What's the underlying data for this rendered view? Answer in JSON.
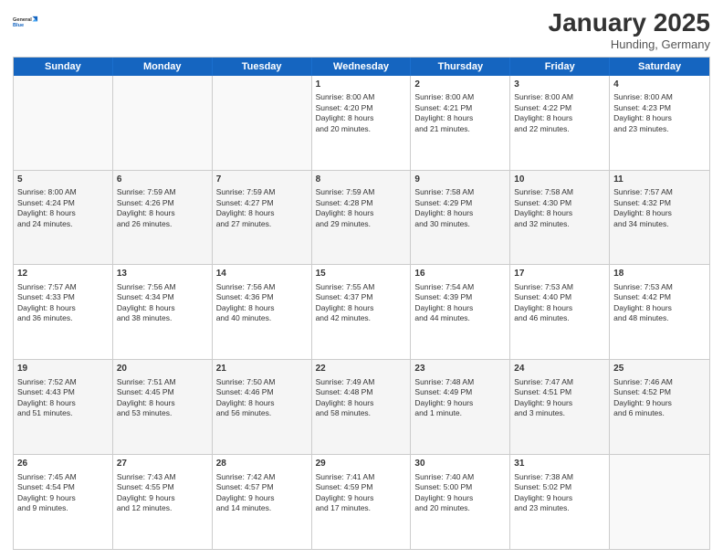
{
  "header": {
    "logo_line1": "General",
    "logo_line2": "Blue",
    "month": "January 2025",
    "location": "Hunding, Germany"
  },
  "days_of_week": [
    "Sunday",
    "Monday",
    "Tuesday",
    "Wednesday",
    "Thursday",
    "Friday",
    "Saturday"
  ],
  "weeks": [
    [
      {
        "num": "",
        "content": ""
      },
      {
        "num": "",
        "content": ""
      },
      {
        "num": "",
        "content": ""
      },
      {
        "num": "1",
        "content": "Sunrise: 8:00 AM\nSunset: 4:20 PM\nDaylight: 8 hours\nand 20 minutes."
      },
      {
        "num": "2",
        "content": "Sunrise: 8:00 AM\nSunset: 4:21 PM\nDaylight: 8 hours\nand 21 minutes."
      },
      {
        "num": "3",
        "content": "Sunrise: 8:00 AM\nSunset: 4:22 PM\nDaylight: 8 hours\nand 22 minutes."
      },
      {
        "num": "4",
        "content": "Sunrise: 8:00 AM\nSunset: 4:23 PM\nDaylight: 8 hours\nand 23 minutes."
      }
    ],
    [
      {
        "num": "5",
        "content": "Sunrise: 8:00 AM\nSunset: 4:24 PM\nDaylight: 8 hours\nand 24 minutes."
      },
      {
        "num": "6",
        "content": "Sunrise: 7:59 AM\nSunset: 4:26 PM\nDaylight: 8 hours\nand 26 minutes."
      },
      {
        "num": "7",
        "content": "Sunrise: 7:59 AM\nSunset: 4:27 PM\nDaylight: 8 hours\nand 27 minutes."
      },
      {
        "num": "8",
        "content": "Sunrise: 7:59 AM\nSunset: 4:28 PM\nDaylight: 8 hours\nand 29 minutes."
      },
      {
        "num": "9",
        "content": "Sunrise: 7:58 AM\nSunset: 4:29 PM\nDaylight: 8 hours\nand 30 minutes."
      },
      {
        "num": "10",
        "content": "Sunrise: 7:58 AM\nSunset: 4:30 PM\nDaylight: 8 hours\nand 32 minutes."
      },
      {
        "num": "11",
        "content": "Sunrise: 7:57 AM\nSunset: 4:32 PM\nDaylight: 8 hours\nand 34 minutes."
      }
    ],
    [
      {
        "num": "12",
        "content": "Sunrise: 7:57 AM\nSunset: 4:33 PM\nDaylight: 8 hours\nand 36 minutes."
      },
      {
        "num": "13",
        "content": "Sunrise: 7:56 AM\nSunset: 4:34 PM\nDaylight: 8 hours\nand 38 minutes."
      },
      {
        "num": "14",
        "content": "Sunrise: 7:56 AM\nSunset: 4:36 PM\nDaylight: 8 hours\nand 40 minutes."
      },
      {
        "num": "15",
        "content": "Sunrise: 7:55 AM\nSunset: 4:37 PM\nDaylight: 8 hours\nand 42 minutes."
      },
      {
        "num": "16",
        "content": "Sunrise: 7:54 AM\nSunset: 4:39 PM\nDaylight: 8 hours\nand 44 minutes."
      },
      {
        "num": "17",
        "content": "Sunrise: 7:53 AM\nSunset: 4:40 PM\nDaylight: 8 hours\nand 46 minutes."
      },
      {
        "num": "18",
        "content": "Sunrise: 7:53 AM\nSunset: 4:42 PM\nDaylight: 8 hours\nand 48 minutes."
      }
    ],
    [
      {
        "num": "19",
        "content": "Sunrise: 7:52 AM\nSunset: 4:43 PM\nDaylight: 8 hours\nand 51 minutes."
      },
      {
        "num": "20",
        "content": "Sunrise: 7:51 AM\nSunset: 4:45 PM\nDaylight: 8 hours\nand 53 minutes."
      },
      {
        "num": "21",
        "content": "Sunrise: 7:50 AM\nSunset: 4:46 PM\nDaylight: 8 hours\nand 56 minutes."
      },
      {
        "num": "22",
        "content": "Sunrise: 7:49 AM\nSunset: 4:48 PM\nDaylight: 8 hours\nand 58 minutes."
      },
      {
        "num": "23",
        "content": "Sunrise: 7:48 AM\nSunset: 4:49 PM\nDaylight: 9 hours\nand 1 minute."
      },
      {
        "num": "24",
        "content": "Sunrise: 7:47 AM\nSunset: 4:51 PM\nDaylight: 9 hours\nand 3 minutes."
      },
      {
        "num": "25",
        "content": "Sunrise: 7:46 AM\nSunset: 4:52 PM\nDaylight: 9 hours\nand 6 minutes."
      }
    ],
    [
      {
        "num": "26",
        "content": "Sunrise: 7:45 AM\nSunset: 4:54 PM\nDaylight: 9 hours\nand 9 minutes."
      },
      {
        "num": "27",
        "content": "Sunrise: 7:43 AM\nSunset: 4:55 PM\nDaylight: 9 hours\nand 12 minutes."
      },
      {
        "num": "28",
        "content": "Sunrise: 7:42 AM\nSunset: 4:57 PM\nDaylight: 9 hours\nand 14 minutes."
      },
      {
        "num": "29",
        "content": "Sunrise: 7:41 AM\nSunset: 4:59 PM\nDaylight: 9 hours\nand 17 minutes."
      },
      {
        "num": "30",
        "content": "Sunrise: 7:40 AM\nSunset: 5:00 PM\nDaylight: 9 hours\nand 20 minutes."
      },
      {
        "num": "31",
        "content": "Sunrise: 7:38 AM\nSunset: 5:02 PM\nDaylight: 9 hours\nand 23 minutes."
      },
      {
        "num": "",
        "content": ""
      }
    ]
  ]
}
